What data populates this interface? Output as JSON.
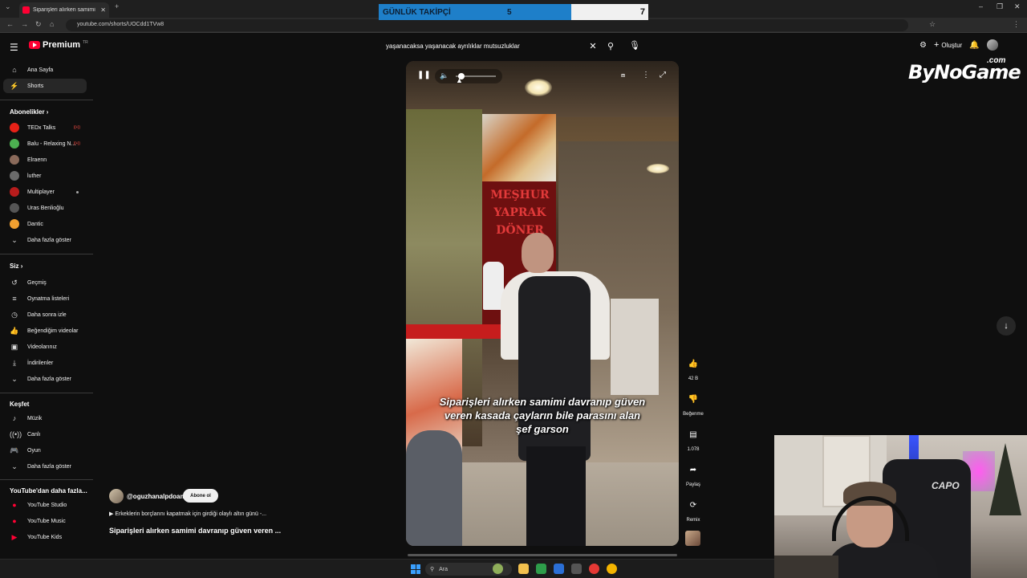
{
  "browser": {
    "tab_title": "Siparişleri alırken samimi da",
    "url": "youtube.com/shorts/UOCdd1TVw8"
  },
  "overlay": {
    "label": "GÜNLÜK TAKİPÇİ",
    "value_left": "5",
    "value_right": "7"
  },
  "header": {
    "logo_text": "Premium",
    "logo_suffix": "TR",
    "search_query": "yaşanacaksa yaşanacak ayrılıklar mutsuzluklar",
    "create_label": "Oluştur"
  },
  "sidebar": {
    "main": [
      {
        "label": "Ana Sayfa",
        "icon": "home-icon"
      },
      {
        "label": "Shorts",
        "icon": "shorts-icon"
      }
    ],
    "subscriptions_title": "Abonelikler",
    "subscriptions": [
      {
        "label": "TEDx Talks",
        "color": "#e62117",
        "live": true
      },
      {
        "label": "Balu - Relaxing N...",
        "color": "#4caf50",
        "live": true
      },
      {
        "label": "Elraenn",
        "color": "#8a6a5a",
        "live": false
      },
      {
        "label": "luther",
        "color": "#6b6b6b",
        "live": false
      },
      {
        "label": "Multiplayer",
        "color": "#b71c1c",
        "live": false,
        "dot": true
      },
      {
        "label": "Uras Benlioğlu",
        "color": "#555555",
        "live": false
      },
      {
        "label": "Dantic",
        "color": "#f0a030",
        "live": false
      }
    ],
    "show_more": "Daha fazla göster",
    "you_title": "Siz",
    "you_items": [
      {
        "label": "Geçmiş",
        "icon": "history-icon"
      },
      {
        "label": "Oynatma listeleri",
        "icon": "playlist-icon"
      },
      {
        "label": "Daha sonra izle",
        "icon": "clock-icon"
      },
      {
        "label": "Beğendiğim videolar",
        "icon": "like-icon"
      },
      {
        "label": "Videolarınız",
        "icon": "video-icon"
      },
      {
        "label": "İndirilenler",
        "icon": "download-icon"
      }
    ],
    "explore_title": "Keşfet",
    "explore_items": [
      {
        "label": "Müzik",
        "icon": "music-icon"
      },
      {
        "label": "Canlı",
        "icon": "live-icon"
      },
      {
        "label": "Oyun",
        "icon": "game-icon"
      }
    ],
    "more_youtube_title": "YouTube'dan daha fazla...",
    "more_youtube_items": [
      {
        "label": "YouTube Studio"
      },
      {
        "label": "YouTube Music"
      },
      {
        "label": "YouTube Kids"
      }
    ]
  },
  "video": {
    "caption": "Siparişleri alırken samimi davranıp güven veren kasada çayların bile parasını alan şef garson",
    "sign_text": "MEŞHUR YAPRAK DÖNER"
  },
  "actions": {
    "likes": "42 B",
    "dislike_label": "Beğenme",
    "comments": "1.078",
    "share_label": "Paylaş",
    "remix_label": "Remix"
  },
  "meta": {
    "channel": "@oguzhanalpdoan",
    "subscribe_label": "Abone ol",
    "playlist": "▶ Erkeklerin borçlarını kapatmak için girdiği olaylı altın günü -...",
    "title": "Siparişleri alırken samimi davranıp güven veren ..."
  },
  "watermark": {
    "text": "ByNoGame",
    "suffix": ".com"
  },
  "webcam": {
    "chair_text": "CAPO"
  },
  "taskbar": {
    "search_placeholder": "Ara"
  }
}
